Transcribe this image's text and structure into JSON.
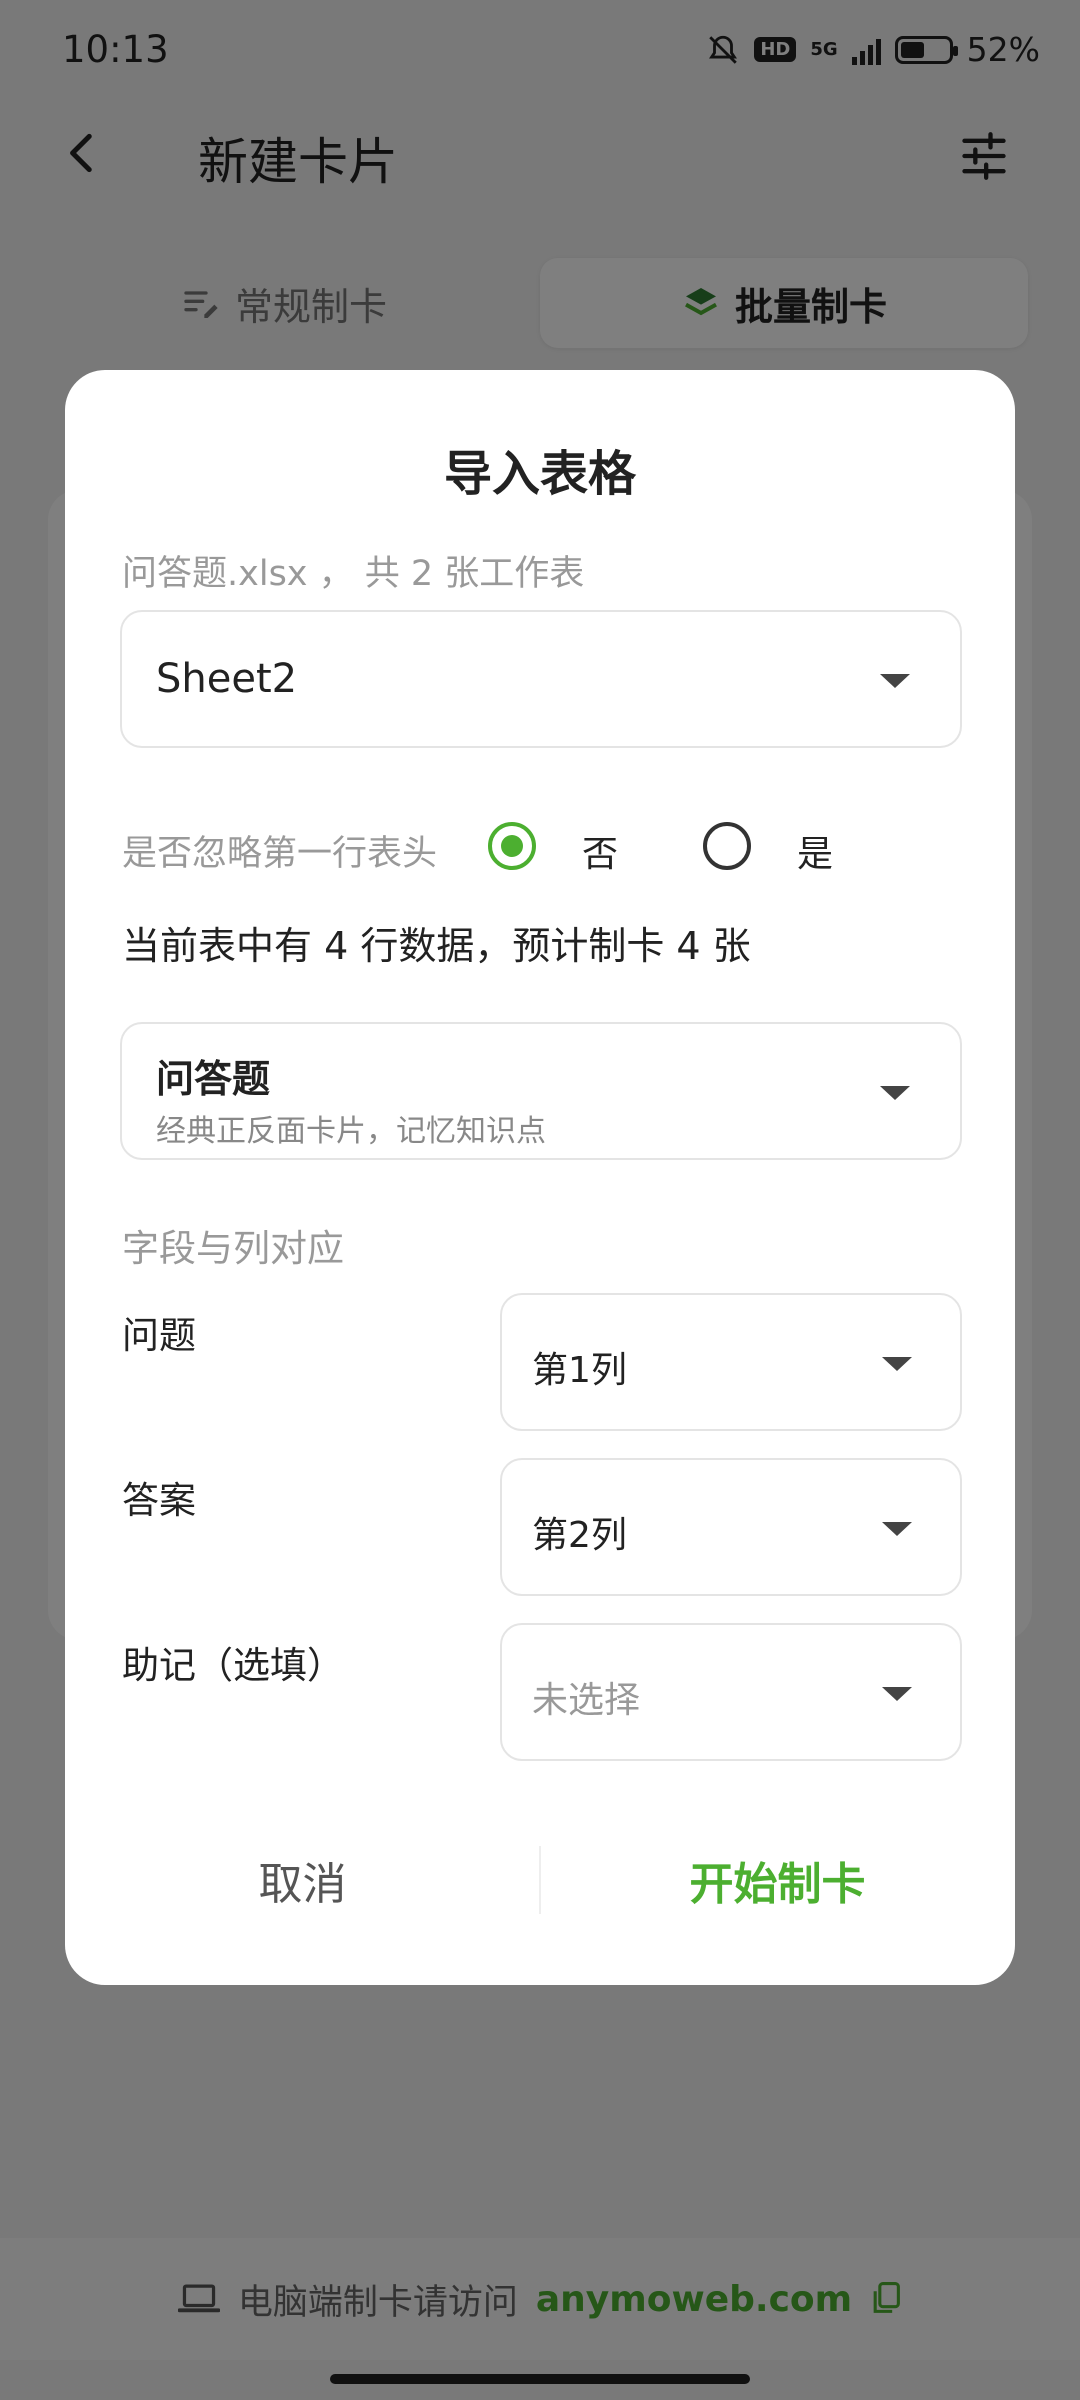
{
  "status": {
    "time": "10:13",
    "network": "5G",
    "hd": "HD",
    "battery": "52%"
  },
  "header": {
    "title": "新建卡片"
  },
  "tabs": [
    {
      "label": "常规制卡"
    },
    {
      "label": "批量制卡"
    }
  ],
  "bottom": {
    "text": "电脑端制卡请访问",
    "link": "anymoweb.com"
  },
  "dialog": {
    "title": "导入表格",
    "file_info": "问答题.xlsx ， 共 2 张工作表",
    "sheet": "Sheet2",
    "ignore_header_label": "是否忽略第一行表头",
    "option_no": "否",
    "option_yes": "是",
    "summary": "当前表中有 4 行数据，预计制卡 4 张",
    "card_type": {
      "name": "问答题",
      "desc": "经典正反面卡片，记忆知识点"
    },
    "mapping_title": "字段与列对应",
    "fields": [
      {
        "label": "问题",
        "value": "第1列"
      },
      {
        "label": "答案",
        "value": "第2列"
      },
      {
        "label": "助记（选填）",
        "value": "未选择"
      }
    ],
    "cancel": "取消",
    "start": "开始制卡"
  },
  "colors": {
    "accent": "#4caf30",
    "overlay": "rgba(0,0,0,0.5)"
  }
}
